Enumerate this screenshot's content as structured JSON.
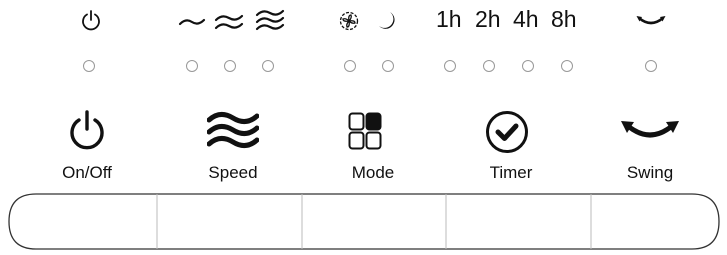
{
  "indicators": {
    "power_icon": "power-icon",
    "speed_icons": [
      "speed-low-icon",
      "speed-mid-icon",
      "speed-high-icon"
    ],
    "mode_icons": [
      "fan-mode-icon",
      "sleep-moon-icon"
    ],
    "timer_labels": [
      "1h",
      "2h",
      "4h",
      "8h"
    ],
    "swing_icon": "swing-arc-icon"
  },
  "leds": {
    "power": 1,
    "speed": 3,
    "mode": 2,
    "timer": 4,
    "swing": 1
  },
  "buttons": [
    {
      "label": "On/Off",
      "icon": "power-icon"
    },
    {
      "label": "Speed",
      "icon": "speed-waves-icon"
    },
    {
      "label": "Mode",
      "icon": "mode-grid-icon"
    },
    {
      "label": "Timer",
      "icon": "timer-check-icon"
    },
    {
      "label": "Swing",
      "icon": "swing-arc-icon"
    }
  ],
  "colors": {
    "ink": "#111111",
    "led_outline": "#999999",
    "panel_outline": "#333333",
    "divider": "#bbbbbb"
  }
}
